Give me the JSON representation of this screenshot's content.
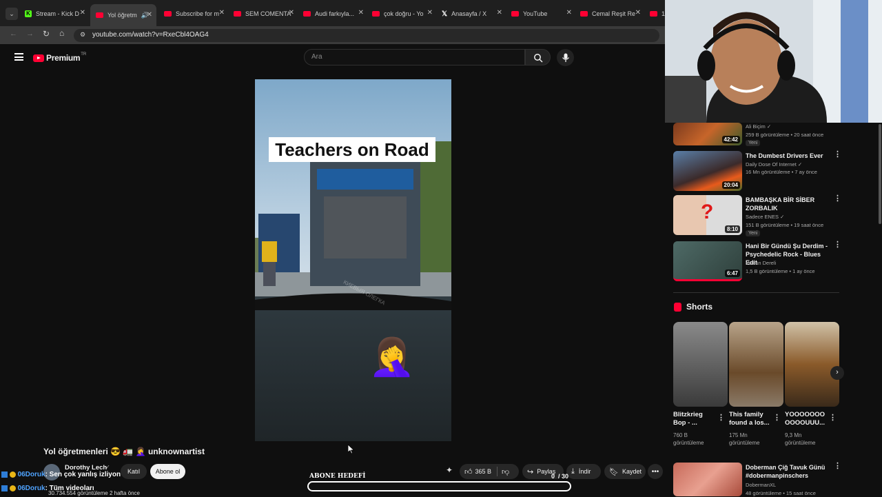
{
  "browser": {
    "tabs": [
      {
        "label": "Stream - Kick D"
      },
      {
        "label": "Yol öğretm"
      },
      {
        "label": "Subscribe for m"
      },
      {
        "label": "SEM COMENTA"
      },
      {
        "label": "Audi farkıyla..."
      },
      {
        "label": "çok doğru - Yo"
      },
      {
        "label": "Anasayfa / X"
      },
      {
        "label": "YouTube"
      },
      {
        "label": "Cemal Reşit Re"
      },
      {
        "label": "1("
      }
    ],
    "url": "youtube.com/watch?v=RxeCbl4OAG4"
  },
  "header": {
    "logo_text": "Premium",
    "logo_region": "TR",
    "search_placeholder": "Ara"
  },
  "video": {
    "overlay_title": "Teachers on Road",
    "watermark": "КИЕВЫЯ ОЛЕГКА",
    "title": "Yol öğretmenleri 😎 🚛 🤦‍♀️ unknownartist",
    "channel": "Dorothy Lech",
    "join_label": "Katıl",
    "subscribe_label": "Abone ol",
    "likes": "365 B",
    "share_label": "Paylaş",
    "download_label": "İndir",
    "save_label": "Kaydet",
    "views_line": "30.734.554 görüntüleme  2 hafta önce"
  },
  "recommendations": [
    {
      "title": "",
      "channel": "Ali Biçim ✓",
      "meta": "259 B görüntüleme • 20 saat önce",
      "badge": "Yeni",
      "duration": "42:42"
    },
    {
      "title": "The Dumbest Drivers Ever",
      "channel": "Daily Dose Of Internet ✓",
      "meta": "16 Mn görüntüleme • 7 ay önce",
      "duration": "20:04"
    },
    {
      "title": "BAMBAŞKA BİR SİBER ZORBALIK",
      "channel": "Sadece ENES ✓",
      "meta": "151 B görüntüleme • 19 saat önce",
      "badge": "Yeni",
      "duration": "8:10"
    },
    {
      "title": "Hani Bir Gündü Şu Derdim - Psychedelic Rock - Blues Edit",
      "channel": "Volkan Dereli",
      "meta": "1,5 B görüntüleme • 1 ay önce",
      "duration": "6:47"
    }
  ],
  "shorts": {
    "heading": "Shorts",
    "items": [
      {
        "title": "Blitzkrieg Bop - ...",
        "views": "760 B görüntüleme"
      },
      {
        "title": "This family found a los...",
        "views": "175 Mn görüntüleme"
      },
      {
        "title": "YOOOOOOO OOOOUUU...",
        "views": "9,3 Mn görüntüleme"
      }
    ]
  },
  "last_rec": {
    "title": "Doberman Çiğ Tavuk Günü #dobermanpinschers",
    "channel": "DobermanXL",
    "meta": "48 görüntüleme • 15 saat önce"
  },
  "stream_overlay": {
    "chat": [
      {
        "user": "06Doruk",
        "message": ": Sen çok yanlış izliyon"
      },
      {
        "user": "06Doruk",
        "message": ": Tüm videoları"
      }
    ],
    "goal_label": "ABONE HEDEFİ",
    "goal_current": "0",
    "goal_total": "/ 30",
    "goal_progress": 0
  },
  "colors": {
    "accent": "#ff0033",
    "bg": "#0f0f0f"
  }
}
